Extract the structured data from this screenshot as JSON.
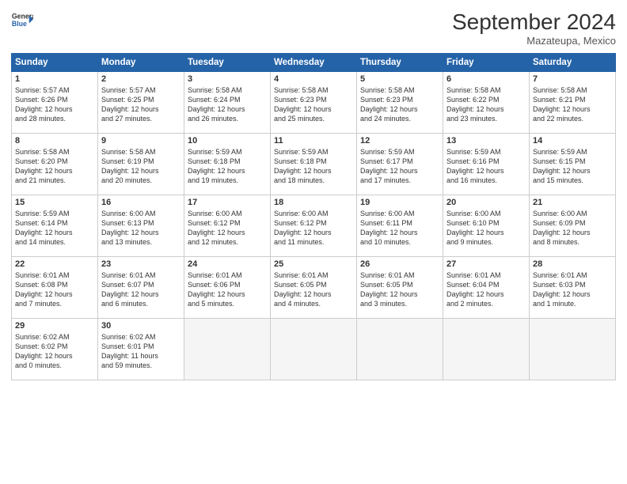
{
  "header": {
    "logo_line1": "General",
    "logo_line2": "Blue",
    "month": "September 2024",
    "location": "Mazateupa, Mexico"
  },
  "days_of_week": [
    "Sunday",
    "Monday",
    "Tuesday",
    "Wednesday",
    "Thursday",
    "Friday",
    "Saturday"
  ],
  "weeks": [
    [
      {
        "day": "1",
        "info": "Sunrise: 5:57 AM\nSunset: 6:26 PM\nDaylight: 12 hours\nand 28 minutes."
      },
      {
        "day": "2",
        "info": "Sunrise: 5:57 AM\nSunset: 6:25 PM\nDaylight: 12 hours\nand 27 minutes."
      },
      {
        "day": "3",
        "info": "Sunrise: 5:58 AM\nSunset: 6:24 PM\nDaylight: 12 hours\nand 26 minutes."
      },
      {
        "day": "4",
        "info": "Sunrise: 5:58 AM\nSunset: 6:23 PM\nDaylight: 12 hours\nand 25 minutes."
      },
      {
        "day": "5",
        "info": "Sunrise: 5:58 AM\nSunset: 6:23 PM\nDaylight: 12 hours\nand 24 minutes."
      },
      {
        "day": "6",
        "info": "Sunrise: 5:58 AM\nSunset: 6:22 PM\nDaylight: 12 hours\nand 23 minutes."
      },
      {
        "day": "7",
        "info": "Sunrise: 5:58 AM\nSunset: 6:21 PM\nDaylight: 12 hours\nand 22 minutes."
      }
    ],
    [
      {
        "day": "8",
        "info": "Sunrise: 5:58 AM\nSunset: 6:20 PM\nDaylight: 12 hours\nand 21 minutes."
      },
      {
        "day": "9",
        "info": "Sunrise: 5:58 AM\nSunset: 6:19 PM\nDaylight: 12 hours\nand 20 minutes."
      },
      {
        "day": "10",
        "info": "Sunrise: 5:59 AM\nSunset: 6:18 PM\nDaylight: 12 hours\nand 19 minutes."
      },
      {
        "day": "11",
        "info": "Sunrise: 5:59 AM\nSunset: 6:18 PM\nDaylight: 12 hours\nand 18 minutes."
      },
      {
        "day": "12",
        "info": "Sunrise: 5:59 AM\nSunset: 6:17 PM\nDaylight: 12 hours\nand 17 minutes."
      },
      {
        "day": "13",
        "info": "Sunrise: 5:59 AM\nSunset: 6:16 PM\nDaylight: 12 hours\nand 16 minutes."
      },
      {
        "day": "14",
        "info": "Sunrise: 5:59 AM\nSunset: 6:15 PM\nDaylight: 12 hours\nand 15 minutes."
      }
    ],
    [
      {
        "day": "15",
        "info": "Sunrise: 5:59 AM\nSunset: 6:14 PM\nDaylight: 12 hours\nand 14 minutes."
      },
      {
        "day": "16",
        "info": "Sunrise: 6:00 AM\nSunset: 6:13 PM\nDaylight: 12 hours\nand 13 minutes."
      },
      {
        "day": "17",
        "info": "Sunrise: 6:00 AM\nSunset: 6:12 PM\nDaylight: 12 hours\nand 12 minutes."
      },
      {
        "day": "18",
        "info": "Sunrise: 6:00 AM\nSunset: 6:12 PM\nDaylight: 12 hours\nand 11 minutes."
      },
      {
        "day": "19",
        "info": "Sunrise: 6:00 AM\nSunset: 6:11 PM\nDaylight: 12 hours\nand 10 minutes."
      },
      {
        "day": "20",
        "info": "Sunrise: 6:00 AM\nSunset: 6:10 PM\nDaylight: 12 hours\nand 9 minutes."
      },
      {
        "day": "21",
        "info": "Sunrise: 6:00 AM\nSunset: 6:09 PM\nDaylight: 12 hours\nand 8 minutes."
      }
    ],
    [
      {
        "day": "22",
        "info": "Sunrise: 6:01 AM\nSunset: 6:08 PM\nDaylight: 12 hours\nand 7 minutes."
      },
      {
        "day": "23",
        "info": "Sunrise: 6:01 AM\nSunset: 6:07 PM\nDaylight: 12 hours\nand 6 minutes."
      },
      {
        "day": "24",
        "info": "Sunrise: 6:01 AM\nSunset: 6:06 PM\nDaylight: 12 hours\nand 5 minutes."
      },
      {
        "day": "25",
        "info": "Sunrise: 6:01 AM\nSunset: 6:05 PM\nDaylight: 12 hours\nand 4 minutes."
      },
      {
        "day": "26",
        "info": "Sunrise: 6:01 AM\nSunset: 6:05 PM\nDaylight: 12 hours\nand 3 minutes."
      },
      {
        "day": "27",
        "info": "Sunrise: 6:01 AM\nSunset: 6:04 PM\nDaylight: 12 hours\nand 2 minutes."
      },
      {
        "day": "28",
        "info": "Sunrise: 6:01 AM\nSunset: 6:03 PM\nDaylight: 12 hours\nand 1 minute."
      }
    ],
    [
      {
        "day": "29",
        "info": "Sunrise: 6:02 AM\nSunset: 6:02 PM\nDaylight: 12 hours\nand 0 minutes."
      },
      {
        "day": "30",
        "info": "Sunrise: 6:02 AM\nSunset: 6:01 PM\nDaylight: 11 hours\nand 59 minutes."
      },
      null,
      null,
      null,
      null,
      null
    ]
  ]
}
